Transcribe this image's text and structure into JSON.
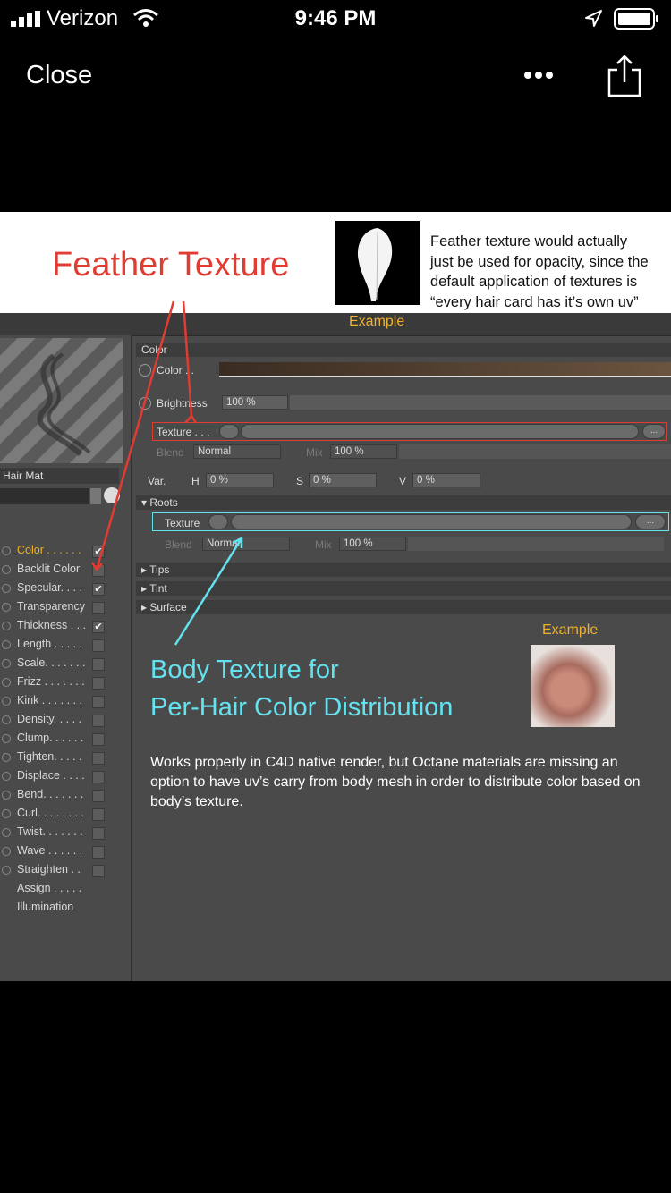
{
  "status_bar": {
    "carrier": "Verizon",
    "time": "9:46 PM"
  },
  "nav": {
    "close_label": "Close",
    "more_icon": "more-icon",
    "share_icon": "share-icon"
  },
  "image": {
    "feather_title": "Feather Texture",
    "feather_note": [
      "Feather texture would actually",
      "just be used for opacity, since the",
      "default application of textures is",
      "“every hair card has it’s own uv”"
    ],
    "example_top": "Example",
    "panel": {
      "hair_mat": "Hair Mat",
      "channels": [
        {
          "label": "Color . . . . . .",
          "checked": "✔"
        },
        {
          "label": "Backlit Color",
          "checked": ""
        },
        {
          "label": "Specular. . . .",
          "checked": "✔"
        },
        {
          "label": "Transparency",
          "checked": ""
        },
        {
          "label": "Thickness . . .",
          "checked": "✔"
        },
        {
          "label": "Length . . . . .",
          "checked": ""
        },
        {
          "label": "Scale. . . . . . .",
          "checked": ""
        },
        {
          "label": "Frizz . . . . . . .",
          "checked": ""
        },
        {
          "label": "Kink . . . . . . .",
          "checked": ""
        },
        {
          "label": "Density. . . . .",
          "checked": ""
        },
        {
          "label": "Clump. . . . . .",
          "checked": ""
        },
        {
          "label": "Tighten. . . . .",
          "checked": ""
        },
        {
          "label": "Displace . . . .",
          "checked": ""
        },
        {
          "label": "Bend. . . . . . .",
          "checked": ""
        },
        {
          "label": "Curl. . . . . . . .",
          "checked": ""
        },
        {
          "label": "Twist. . . . . . .",
          "checked": ""
        },
        {
          "label": "Wave . . . . . .",
          "checked": ""
        },
        {
          "label": "Straighten . .",
          "checked": ""
        },
        {
          "label": "Assign . . . . .",
          "checked": ""
        },
        {
          "label": "Illumination",
          "checked": ""
        }
      ],
      "color_section": "Color",
      "color_label": "Color . .",
      "brightness_label": "Brightness",
      "brightness_value": "100 %",
      "texture_label": "Texture . . .",
      "blend_label": "Blend",
      "blend_value": "Normal",
      "mix_label": "Mix",
      "mix_value": "100 %",
      "var_label": "Var.",
      "h_label": "H",
      "h_value": "0 %",
      "s_label": "S",
      "s_value": "0 %",
      "v_label": "V",
      "v_value": "0 %",
      "roots_section": "▾ Roots",
      "roots_texture_label": "Texture",
      "tips_section": "▸ Tips",
      "tint_section": "▸ Tint",
      "surface_section": "▸ Surface",
      "ellipsis": "..."
    },
    "body_title_1": "Body Texture for",
    "body_title_2": "Per-Hair Color Distribution",
    "example_bottom": "Example",
    "works_text": "Works properly in C4D native render, but Octane materials are missing an option to have uv’s carry from body mesh in order to distribute color based on body’s texture."
  },
  "colors": {
    "title_red": "#e03c32",
    "body_cyan": "#63e2ef",
    "example_orange": "#f0b22a"
  }
}
